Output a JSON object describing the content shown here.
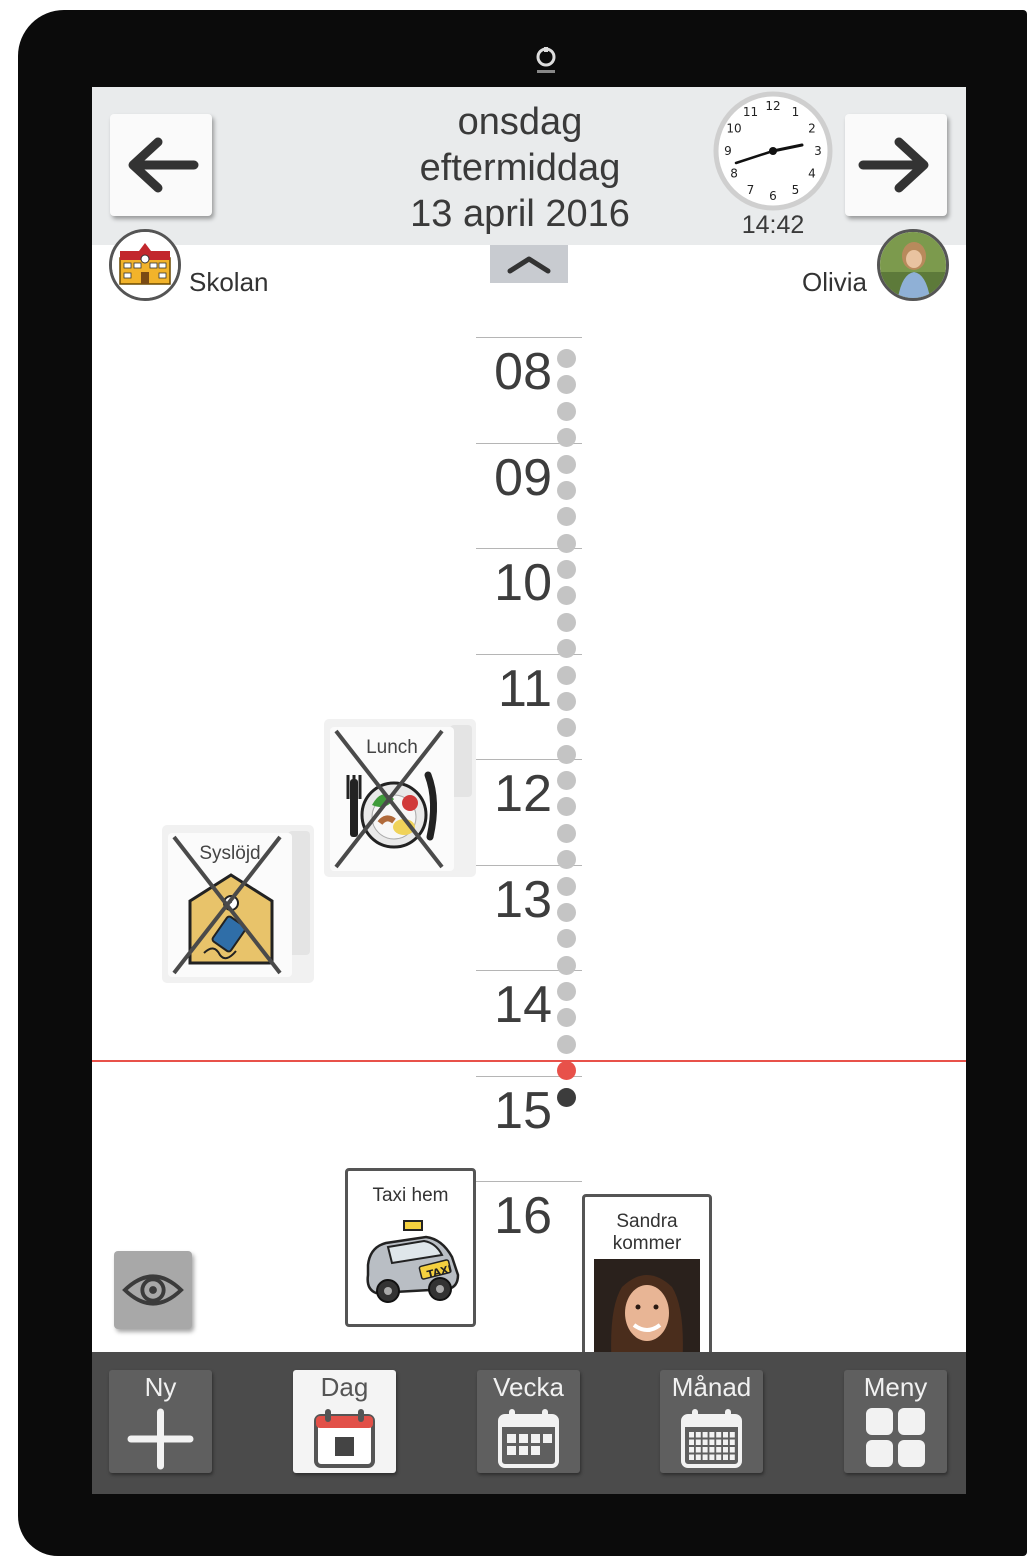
{
  "header": {
    "weekday": "onsdag",
    "part_of_day": "eftermiddag",
    "date": "13 april 2016",
    "clock_time": "14:42",
    "clock_numbers": [
      "12",
      "1",
      "2",
      "3",
      "4",
      "5",
      "6",
      "7",
      "8",
      "9",
      "10",
      "11"
    ]
  },
  "location": {
    "label": "Skolan"
  },
  "user": {
    "name": "Olivia"
  },
  "timeline": {
    "hours": [
      "08",
      "09",
      "10",
      "11",
      "12",
      "13",
      "14",
      "15",
      "16"
    ],
    "current_time": "14:42"
  },
  "activities": {
    "lunch": {
      "title": "Lunch",
      "status": "done"
    },
    "sysljod": {
      "title": "Syslöjd",
      "status": "done"
    },
    "taxi": {
      "title": "Taxi hem",
      "sign": "TAXI"
    },
    "sandra": {
      "title_line1": "Sandra",
      "title_line2": "kommer"
    }
  },
  "toolbar": {
    "new_label": "Ny",
    "day_label": "Dag",
    "week_label": "Vecka",
    "month_label": "Månad",
    "menu_label": "Meny"
  },
  "colors": {
    "now_line": "#e8514a",
    "past_dot": "#c4c4c4",
    "future_dot": "#3c3c3c",
    "toolbar": "#4b4b4b"
  }
}
